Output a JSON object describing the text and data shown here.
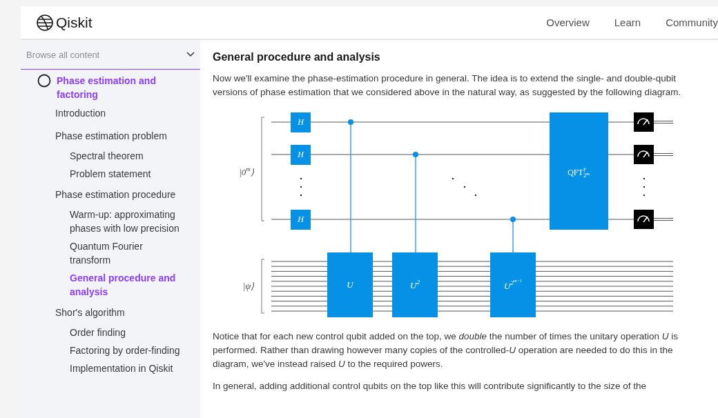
{
  "header": {
    "logo": "Qiskit",
    "nav": [
      {
        "label": "Overview"
      },
      {
        "label": "Learn"
      },
      {
        "label": "Community"
      }
    ]
  },
  "sidebar": {
    "browse": "Browse all content",
    "section": "Phase estimation and factoring",
    "items": [
      {
        "label": "Introduction",
        "selected": false
      },
      {
        "label": "Phase estimation problem",
        "selected": false,
        "children": [
          {
            "label": "Spectral theorem",
            "selected": false
          },
          {
            "label": "Problem statement",
            "selected": false
          }
        ]
      },
      {
        "label": "Phase estimation procedure",
        "selected": false,
        "children": [
          {
            "label": "Warm-up: approximating phases with low precision",
            "selected": false
          },
          {
            "label": "Quantum Fourier transform",
            "selected": false
          },
          {
            "label": "General procedure and analysis",
            "selected": true
          }
        ]
      },
      {
        "label": "Shor's algorithm",
        "selected": false,
        "children": [
          {
            "label": "Order finding",
            "selected": false
          },
          {
            "label": "Factoring by order-finding",
            "selected": false
          },
          {
            "label": "Implementation in Qiskit",
            "selected": false
          }
        ]
      }
    ]
  },
  "content": {
    "heading": "General procedure and analysis",
    "intro": "Now we'll examine the phase-estimation procedure in general. The idea is to extend the single- and double-qubit versions of phase estimation that we considered above in the natural way, as suggested by the following diagram.",
    "circuit": {
      "top_register": {
        "base": "|0",
        "sup": "m",
        "close": "⟩"
      },
      "bottom_register": {
        "base": "|ψ",
        "close": "⟩"
      },
      "hadamard": [
        "H",
        "H",
        "H"
      ],
      "controlled": [
        {
          "base": "U"
        },
        {
          "base": "U",
          "sup": "2"
        },
        {
          "base": "U",
          "sup": "2",
          "supsup": "m−1"
        }
      ],
      "qft": {
        "base": "QFT",
        "sup": "†",
        "sub": "2",
        "subsup": "m"
      }
    },
    "paragraphs": [
      "Notice that for each new control qubit added on the top, we *double* the number of times the unitary operation *U* is performed. Rather than drawing however many copies of the controlled-*U* operation are needed to do this in the diagram, we've instead raised *U* to the required powers.",
      "In general, adding additional control qubits on the top like this will contribute significantly to the size of the"
    ]
  }
}
